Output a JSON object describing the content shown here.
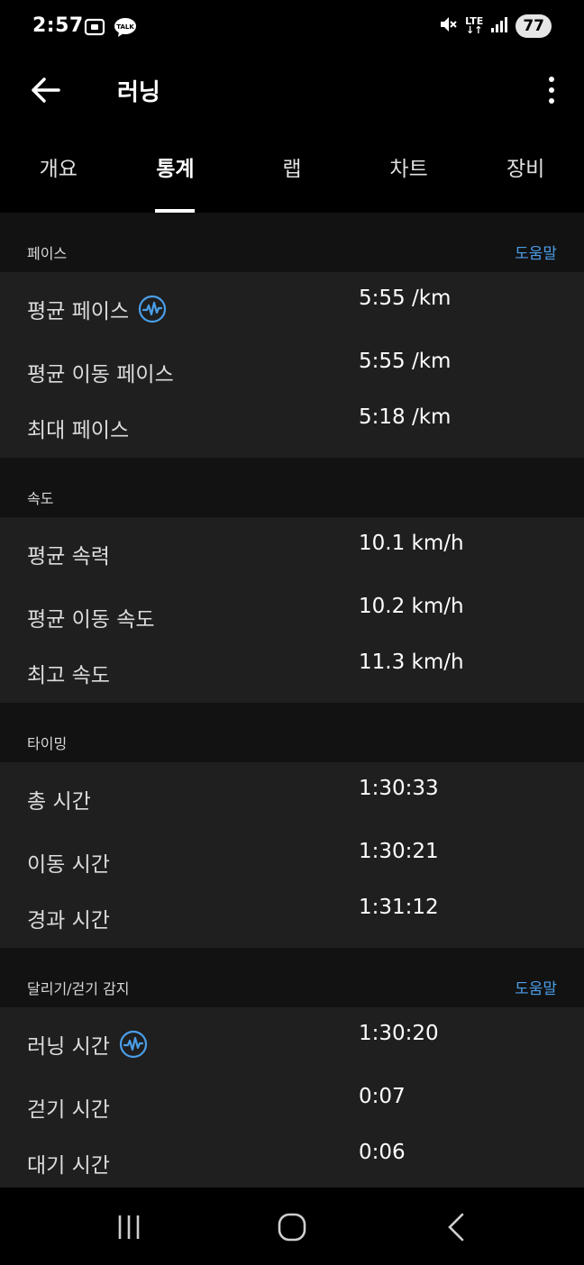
{
  "status": {
    "time": "2:57",
    "talk_badge": "TALK",
    "lte": "LTE",
    "battery": "77"
  },
  "app_bar": {
    "title": "러닝"
  },
  "tabs": [
    {
      "label": "개요",
      "active": false
    },
    {
      "label": "통계",
      "active": true
    },
    {
      "label": "랩",
      "active": false
    },
    {
      "label": "차트",
      "active": false
    },
    {
      "label": "장비",
      "active": false
    }
  ],
  "sections": [
    {
      "title": "페이스",
      "help": "도움말",
      "rows": [
        {
          "label": "평균 페이스",
          "value": "5:55 /km",
          "icon": "heart-rate-icon"
        },
        {
          "label": "평균 이동 페이스",
          "value": "5:55 /km"
        },
        {
          "label": "최대 페이스",
          "value": "5:18 /km"
        }
      ]
    },
    {
      "title": "속도",
      "rows": [
        {
          "label": "평균 속력",
          "value": "10.1 km/h"
        },
        {
          "label": "평균 이동 속도",
          "value": "10.2 km/h"
        },
        {
          "label": "최고 속도",
          "value": "11.3 km/h"
        }
      ]
    },
    {
      "title": "타이밍",
      "rows": [
        {
          "label": "총 시간",
          "value": "1:30:33"
        },
        {
          "label": "이동 시간",
          "value": "1:30:21"
        },
        {
          "label": "경과 시간",
          "value": "1:31:12"
        }
      ]
    },
    {
      "title": "달리기/걷기 감지",
      "help": "도움말",
      "rows": [
        {
          "label": "러닝 시간",
          "value": "1:30:20",
          "icon": "heart-rate-icon"
        },
        {
          "label": "걷기 시간",
          "value": "0:07"
        },
        {
          "label": "대기 시간",
          "value": "0:06"
        }
      ]
    }
  ],
  "colors": {
    "accent": "#4a9ee8",
    "background": "#121212",
    "card": "#1f1f1f"
  }
}
